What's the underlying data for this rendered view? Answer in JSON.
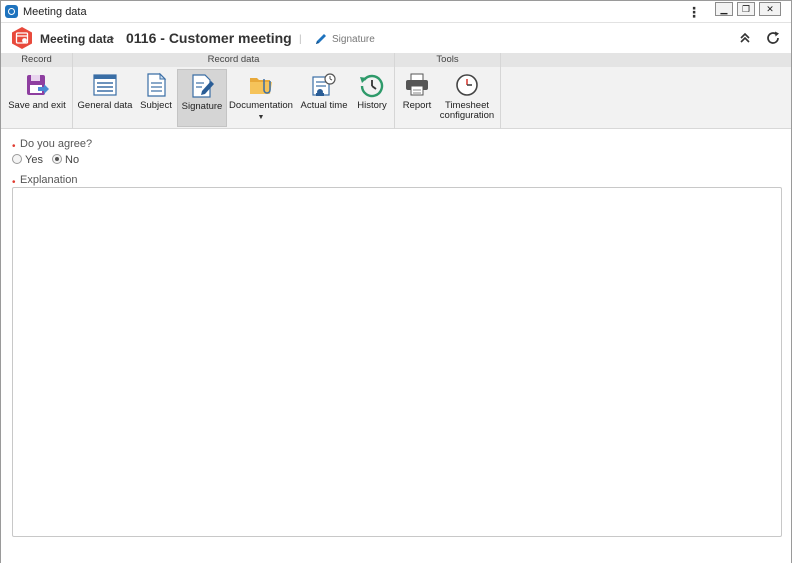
{
  "window": {
    "title": "Meeting data"
  },
  "header": {
    "module": "Meeting data",
    "separator": "›",
    "record_title": "0116 - Customer meeting",
    "divider": "|",
    "current_section": "Signature"
  },
  "ribbon": {
    "groups": [
      {
        "label": "Record"
      },
      {
        "label": "Record data"
      },
      {
        "label": "Tools"
      }
    ],
    "buttons": {
      "save_exit": "Save and exit",
      "general_data": "General data",
      "subject": "Subject",
      "signature": "Signature",
      "documentation": "Documentation",
      "actual_time": "Actual time",
      "history": "History",
      "report": "Report",
      "timesheet_line1": "Timesheet",
      "timesheet_line2": "configuration"
    },
    "active": "Signature"
  },
  "form": {
    "agree_label": "Do you agree?",
    "options": [
      "Yes",
      "No"
    ],
    "selected": "No",
    "explanation_label": "Explanation",
    "explanation_value": ""
  },
  "colors": {
    "required": "#e03c31",
    "accent": "#1e73be",
    "module_icon": "#e84a3c"
  }
}
